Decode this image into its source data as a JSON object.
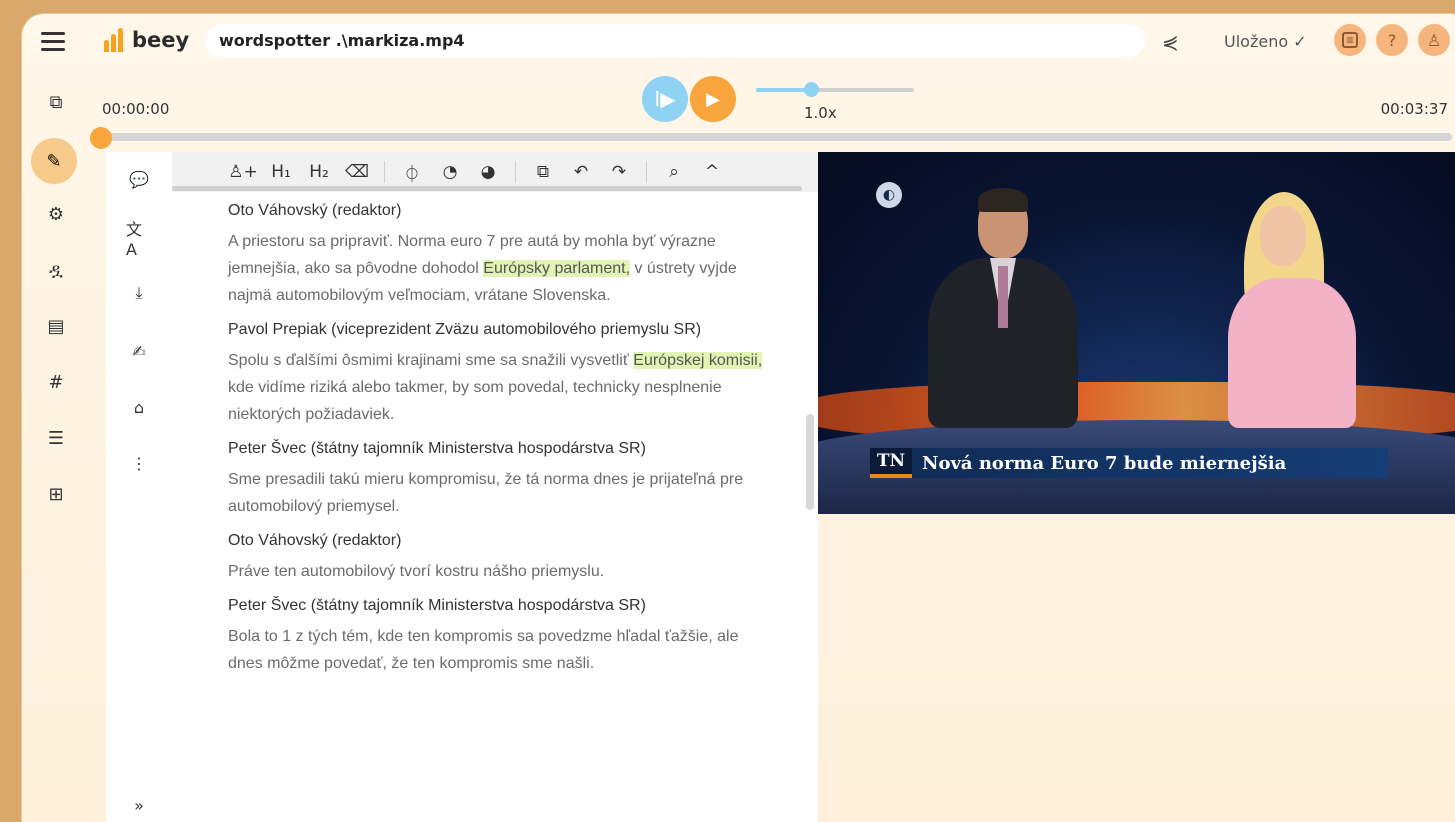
{
  "header": {
    "logo_text": "beey",
    "title": "wordspotter .\\markiza.mp4",
    "saved_status": "Uloženo ✓",
    "buttons": [
      {
        "name": "settings-sliders",
        "glyph": "⊞"
      },
      {
        "name": "help",
        "glyph": "?"
      },
      {
        "name": "user",
        "glyph": "♙"
      }
    ]
  },
  "player": {
    "current_time": "00:00:00",
    "total_time": "00:03:37",
    "speed": "1.0x",
    "speed_fraction": 0.35,
    "progress_fraction": 0.0
  },
  "left_rail": {
    "items": [
      "copy-icon",
      "edit-icon",
      "gear-icon",
      "users-icon",
      "book-icon",
      "hashtag-icon",
      "list-icon",
      "grid-icon"
    ],
    "active": "edit-icon"
  },
  "tool_column": {
    "items": [
      "comment-icon",
      "translate-icon",
      "download-icon",
      "edit-note-icon",
      "tag-icon",
      "more-icon"
    ],
    "expand_glyph": "»"
  },
  "editor_toolbar": {
    "items": [
      "add-speaker",
      "heading-1",
      "heading-2",
      "eraser",
      "timestamp-down",
      "timestamp-a",
      "timestamp-b",
      "copy",
      "undo",
      "redo",
      "search",
      "collapse"
    ]
  },
  "transcript": [
    {
      "speaker": "Oto Váhovský (redaktor)",
      "segments": [
        {
          "t": "A priestoru sa pripraviť. Norma euro 7 pre autá by mohla byť výrazne jemnejšia, ako sa pôvodne dohodol ",
          "h": false
        },
        {
          "t": "Európsky parlament,",
          "h": true
        },
        {
          "t": " v ústrety vyjde najmä automobilovým veľmociam, vrátane Slovenska.",
          "h": false
        }
      ]
    },
    {
      "speaker": "Pavol Prepiak (viceprezident Zväzu automobilového priemyslu SR)",
      "segments": [
        {
          "t": "Spolu s ďalšími ôsmimi krajinami sme sa snažili vysvetliť ",
          "h": false
        },
        {
          "t": "Európskej komisii,",
          "h": true
        },
        {
          "t": " kde vidíme riziká alebo takmer, by som povedal, technicky nesplnenie niektorých požiadaviek.",
          "h": false
        }
      ]
    },
    {
      "speaker": "Peter Švec (štátny tajomník Ministerstva hospodárstva SR)",
      "segments": [
        {
          "t": "Sme presadili takú mieru kompromisu, že tá norma dnes je prijateľná pre automobilový priemysel.",
          "h": false
        }
      ]
    },
    {
      "speaker": "Oto Váhovský (redaktor)",
      "segments": [
        {
          "t": "Práve ten automobilový tvorí kostru nášho priemyslu.",
          "h": false
        }
      ]
    },
    {
      "speaker": "Peter Švec (štátny tajomník Ministerstva hospodárstva SR)",
      "segments": [
        {
          "t": "Bola to 1 z tých tém, kde ten kompromis sa povedzme hľadal ťažšie, ale dnes môžme povedať, že ten kompromis sme našli.",
          "h": false
        }
      ]
    }
  ],
  "video": {
    "channel_logo": "TN",
    "caption": "Nová norma Euro 7 bude miernejšia"
  },
  "colors": {
    "accent_orange": "#f7a53c",
    "accent_blue": "#8fd2f4",
    "highlight": "#e2f3b3"
  }
}
